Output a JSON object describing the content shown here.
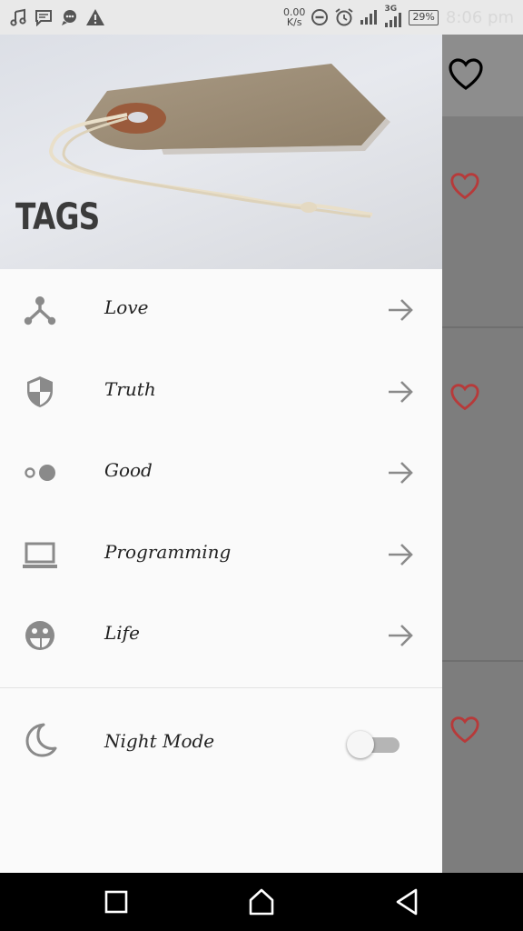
{
  "status_bar": {
    "speed_value": "0.00",
    "speed_unit": "K/s",
    "network_type": "3G",
    "battery": "29%",
    "time": "8:06 pm"
  },
  "drawer": {
    "header_title": "TAGS",
    "items": [
      {
        "label": "Love",
        "icon": "tree-nodes-icon"
      },
      {
        "label": "Truth",
        "icon": "shield-icon"
      },
      {
        "label": "Good",
        "icon": "dots-icon"
      },
      {
        "label": "Programming",
        "icon": "laptop-icon"
      },
      {
        "label": "Life",
        "icon": "face-icon"
      }
    ],
    "night_mode": {
      "label": "Night Mode",
      "icon": "moon-icon",
      "enabled": false
    }
  },
  "colors": {
    "heart": "#b73a3a",
    "icon_gray": "#8a8a8a",
    "drawer_bg": "#fafafa",
    "scrim_bg": "#7d7d7d"
  }
}
